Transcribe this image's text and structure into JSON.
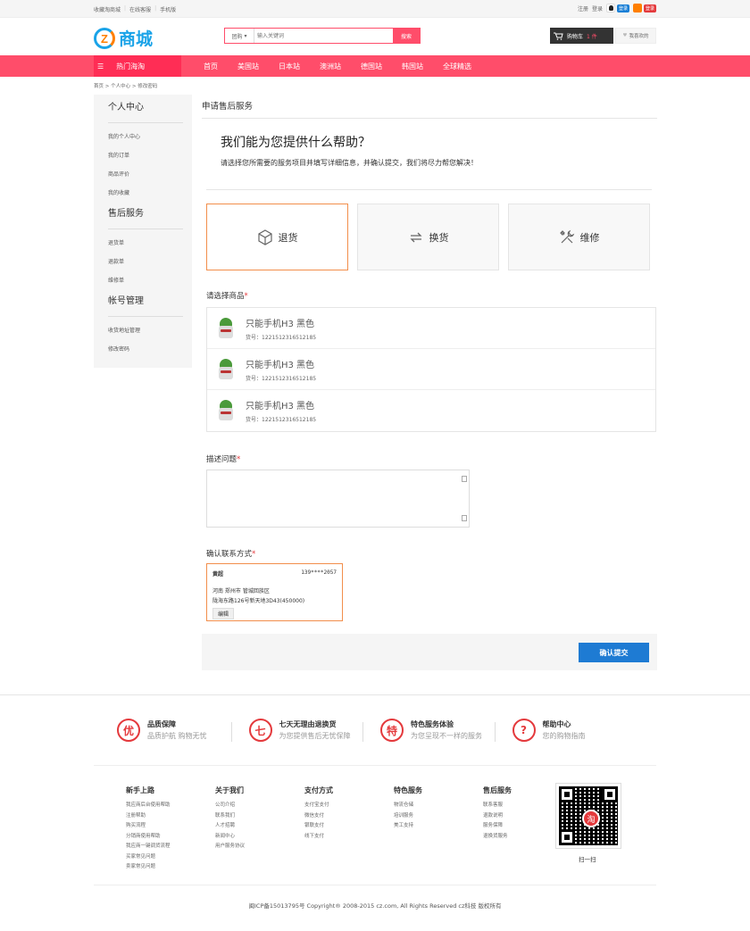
{
  "topbar": {
    "links": [
      "收藏淘商城",
      "在线客服",
      "手机版"
    ],
    "register": "注册",
    "login": "登录",
    "qq_tag": "登录",
    "taobao_tag": "登录"
  },
  "header": {
    "logo_mark": "Z",
    "logo_text": "商城",
    "search_select": "团购",
    "search_placeholder": "输入关键词",
    "search_button": "搜索",
    "cart_label": "购物车",
    "cart_count": "1 件",
    "favorites": "我喜欢的"
  },
  "nav": {
    "category": "热门海淘",
    "items": [
      "首页",
      "美国站",
      "日本站",
      "澳洲站",
      "德国站",
      "韩国站",
      "全球精选"
    ]
  },
  "breadcrumb": "首页 > 个人中心 > 修改密码",
  "sidebar": {
    "groups": [
      {
        "title": "个人中心",
        "items": [
          "我的个人中心",
          "我的订单",
          "商品评价",
          "我的收藏"
        ]
      },
      {
        "title": "售后服务",
        "items": [
          "退货单",
          "退款单",
          "维修单"
        ]
      },
      {
        "title": "帐号管理",
        "items": [
          "收货地址管理",
          "修改密码"
        ]
      }
    ]
  },
  "main": {
    "title": "申请售后服务",
    "help_heading": "我们能为您提供什么帮助？",
    "help_text": "请选择您所需要的服务项目并填写详细信息，并确认提交，我们将尽力帮您解决！",
    "services": [
      {
        "label": "退货",
        "icon": "box-icon"
      },
      {
        "label": "换货",
        "icon": "exchange-icon"
      },
      {
        "label": "维修",
        "icon": "tools-icon"
      }
    ],
    "select_product_label": "请选择商品",
    "products": [
      {
        "name": "只能手机H3 黑色",
        "number": "货号：1221512316512185"
      },
      {
        "name": "只能手机H3 黑色",
        "number": "货号：1221512316512185"
      },
      {
        "name": "只能手机H3 黑色",
        "number": "货号：1221512316512185"
      }
    ],
    "describe_label": "描述问题",
    "contact_label": "确认联系方式",
    "contact": {
      "name": "黄超",
      "phone": "139****2057",
      "address1": "河南 郑州市 管城回族区",
      "address2": "陇海东路126号新天地3D43(450000)",
      "edit": "编辑"
    },
    "submit": "确认提交",
    "required_mark": "*"
  },
  "footer": {
    "features": [
      {
        "icon": "优",
        "title": "品质保障",
        "desc": "品质护航 购物无忧"
      },
      {
        "icon": "七",
        "title": "七天无理由退换货",
        "desc": "为您提供售后无忧保障"
      },
      {
        "icon": "特",
        "title": "特色服务体验",
        "desc": "为您呈现不一样的服务"
      },
      {
        "icon": "?",
        "title": "帮助中心",
        "desc": "您的购物指南"
      }
    ],
    "columns": [
      {
        "title": "新手上路",
        "items": [
          "我应商后台使用帮助",
          "注册帮助",
          "购买流程",
          "分销商使用帮助",
          "我应商一键调货流程",
          "买家常见问题",
          "卖家常见问题"
        ]
      },
      {
        "title": "关于我们",
        "items": [
          "公司介绍",
          "联系我们",
          "人才招聘",
          "新闻中心",
          "用户服务协议"
        ]
      },
      {
        "title": "支付方式",
        "items": [
          "支付宝支付",
          "微信支付",
          "银联支付",
          "线下支付"
        ]
      },
      {
        "title": "特色服务",
        "items": [
          "物流仓储",
          "培训服务",
          "美工支持"
        ]
      },
      {
        "title": "售后服务",
        "items": [
          "联系客服",
          "退款说明",
          "服务保障",
          "退换货服务"
        ]
      }
    ],
    "qr_center": "淘",
    "qr_label": "扫一扫",
    "copyright": "闽ICP备15013795号 Copyright® 2008-2015 cz.com, All Rights Reserved cz科技 版权所有"
  }
}
